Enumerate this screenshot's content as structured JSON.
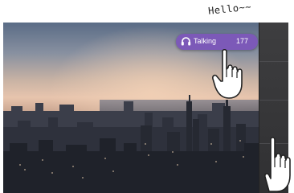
{
  "annotation": {
    "text": "Hello~~"
  },
  "call_pill": {
    "label": "Talking",
    "count": "177",
    "accent_color": "#7c59b8",
    "icon": "headset-icon"
  },
  "background": {
    "type": "city-skyline-photo",
    "colors": {
      "sky_top": "#5a6c86",
      "horizon": "#e7c4ad",
      "city": "#1e2129"
    }
  },
  "side_panel": {
    "color": "#353537"
  },
  "gestures": [
    {
      "icon": "hand-cursor-icon",
      "action": "tap"
    },
    {
      "icon": "hand-cursor-icon",
      "action": "swipe"
    }
  ]
}
